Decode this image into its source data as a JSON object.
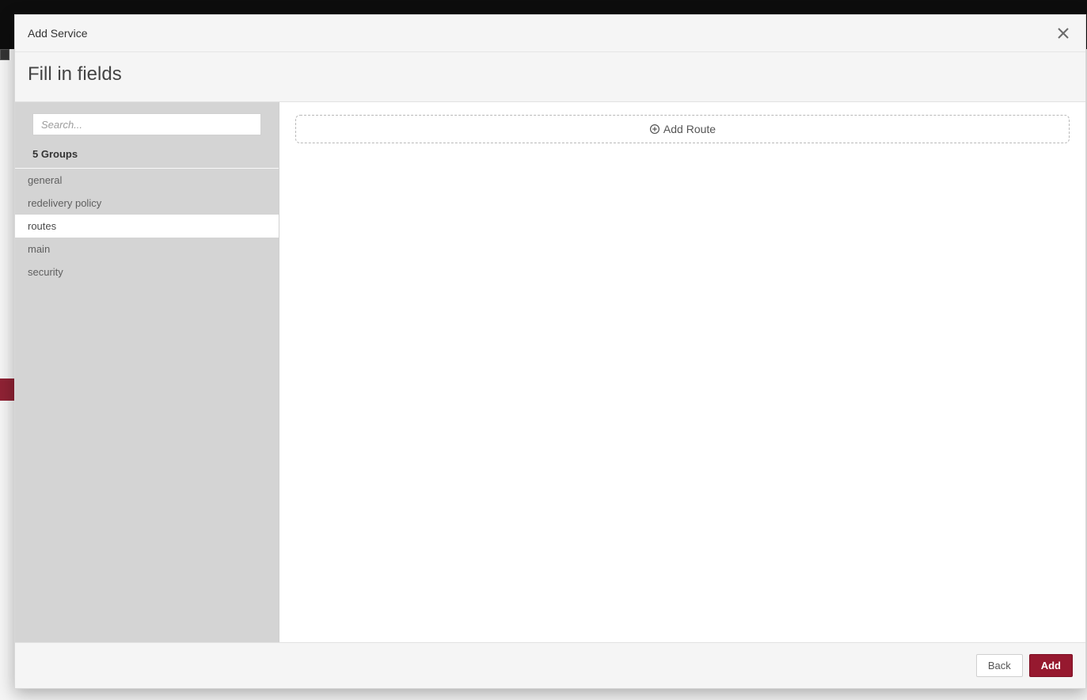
{
  "modal": {
    "title": "Add Service",
    "subtitle": "Fill in fields"
  },
  "sidebar": {
    "search_placeholder": "Search...",
    "groups_count_label": "5 Groups",
    "items": [
      {
        "label": "general",
        "selected": false
      },
      {
        "label": "redelivery policy",
        "selected": false
      },
      {
        "label": "routes",
        "selected": true
      },
      {
        "label": "main",
        "selected": false
      },
      {
        "label": "security",
        "selected": false
      }
    ]
  },
  "main": {
    "add_route_label": "Add Route"
  },
  "footer": {
    "back_label": "Back",
    "add_label": "Add"
  },
  "colors": {
    "accent": "#96192f"
  }
}
